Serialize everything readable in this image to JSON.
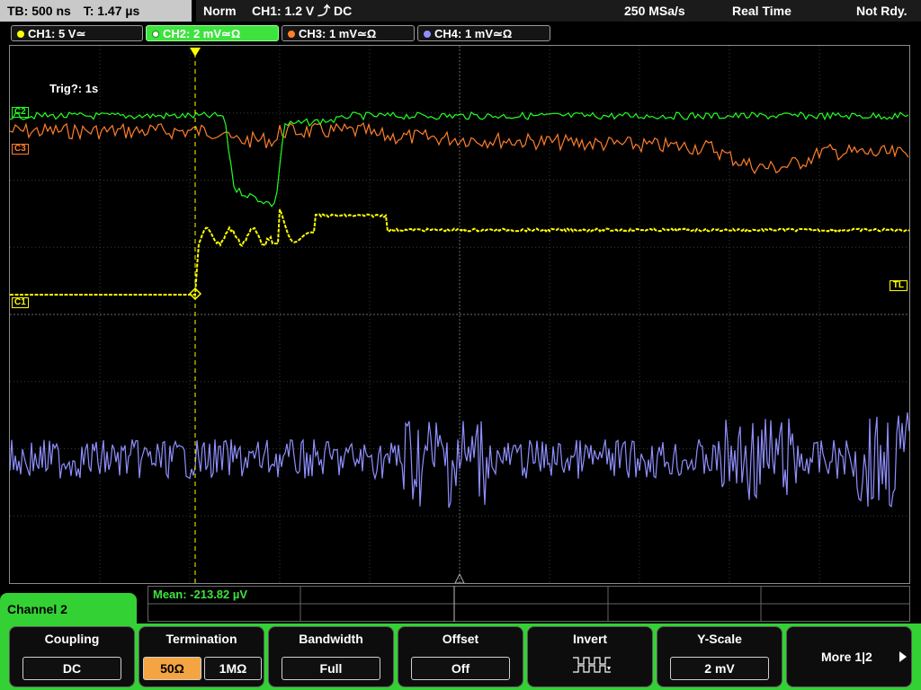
{
  "topbar": {
    "timebase": "TB: 500 ns",
    "trigger_time": "T: 1.47 µs",
    "mode": "Norm",
    "trigger": "CH1: 1.2 V ⤴ DC",
    "sample_rate": "250 MSa/s",
    "acq": "Real Time",
    "status": "Not Rdy."
  },
  "channels": [
    {
      "label": "CH1: 5 V≃",
      "color": "#ffff00"
    },
    {
      "label": "CH2: 2 mV≃Ω",
      "color": "#22ff22"
    },
    {
      "label": "CH3: 1 mV≃Ω",
      "color": "#ff7f2a"
    },
    {
      "label": "CH4: 1 mV≃Ω",
      "color": "#8f8fff"
    }
  ],
  "screen": {
    "trig_info": "Trig?: 1s",
    "marker_c2": "C2",
    "marker_c3": "C3",
    "marker_c1": "C1",
    "marker_tl": "TL"
  },
  "measurement": {
    "text": "Mean: -213.82 µV"
  },
  "menu": {
    "channel": "Channel 2",
    "coupling": {
      "title": "Coupling",
      "value": "DC"
    },
    "termination": {
      "title": "Termination",
      "opt1": "50Ω",
      "opt2": "1MΩ"
    },
    "bandwidth": {
      "title": "Bandwidth",
      "value": "Full"
    },
    "offset": {
      "title": "Offset",
      "value": "Off"
    },
    "invert": {
      "title": "Invert",
      "icon": "invert-waveform-icon"
    },
    "yscale": {
      "title": "Y-Scale",
      "value": "2 mV"
    },
    "more": {
      "label": "More 1|2",
      "icon": "play-right-icon"
    }
  }
}
